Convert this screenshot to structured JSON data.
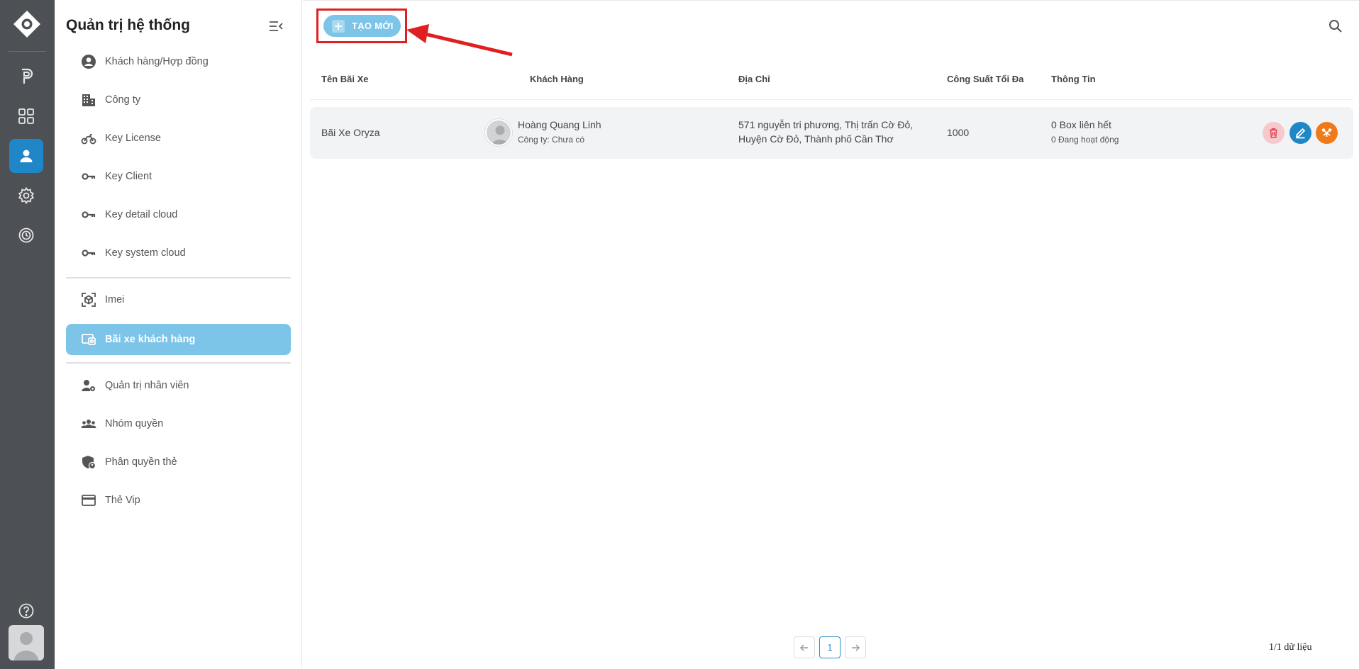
{
  "sidebar": {
    "title": "Quản trị hệ thống",
    "items": [
      {
        "label": "Khách hàng/Hợp đồng",
        "icon": "account-circle-icon"
      },
      {
        "label": "Công ty",
        "icon": "building-icon"
      },
      {
        "label": "Key License",
        "icon": "motorbike-icon"
      },
      {
        "label": "Key Client",
        "icon": "key-icon"
      },
      {
        "label": "Key detail cloud",
        "icon": "key-icon"
      },
      {
        "label": "Key system cloud",
        "icon": "key-icon"
      },
      {
        "label": "Imei",
        "icon": "scan-cube-icon"
      },
      {
        "label": "Bãi xe khách hàng",
        "icon": "parking-lot-icon"
      },
      {
        "label": "Quản trị nhân viên",
        "icon": "user-gear-icon"
      },
      {
        "label": "Nhóm quyền",
        "icon": "users-group-icon"
      },
      {
        "label": "Phân quyền thẻ",
        "icon": "shield-card-icon"
      },
      {
        "label": "Thẻ Vip",
        "icon": "credit-card-icon"
      }
    ]
  },
  "toolbar": {
    "create_label": "TẠO MỚI"
  },
  "table": {
    "headers": [
      "Tên Bãi Xe",
      "Khách Hàng",
      "Địa Chỉ",
      "Công Suất Tối Đa",
      "Thông Tin"
    ],
    "rows": [
      {
        "name": "Bãi Xe Oryza",
        "customer_name": "Hoàng Quang Linh",
        "customer_company": "Công ty: Chưa có",
        "address_line1": "571 nguyễn tri phương, Thị trấn Cờ Đỏ,",
        "address_line2": "Huyện Cờ Đỏ, Thành phố Cần Thơ",
        "capacity": "1000",
        "info_line1": "0 Box liên hết",
        "info_line2": "0 Đang hoạt động"
      }
    ]
  },
  "pagination": {
    "current_page": "1",
    "summary": "1/1 dữ liệu"
  },
  "colors": {
    "rail_bg": "#4d5155",
    "rail_active": "#1f87c8",
    "accent_light": "#7cc4e8",
    "highlight_red": "#e02020",
    "delete_bg": "#f6c9cd",
    "edit_bg": "#1f87c8",
    "extra_bg": "#f07a1a"
  }
}
